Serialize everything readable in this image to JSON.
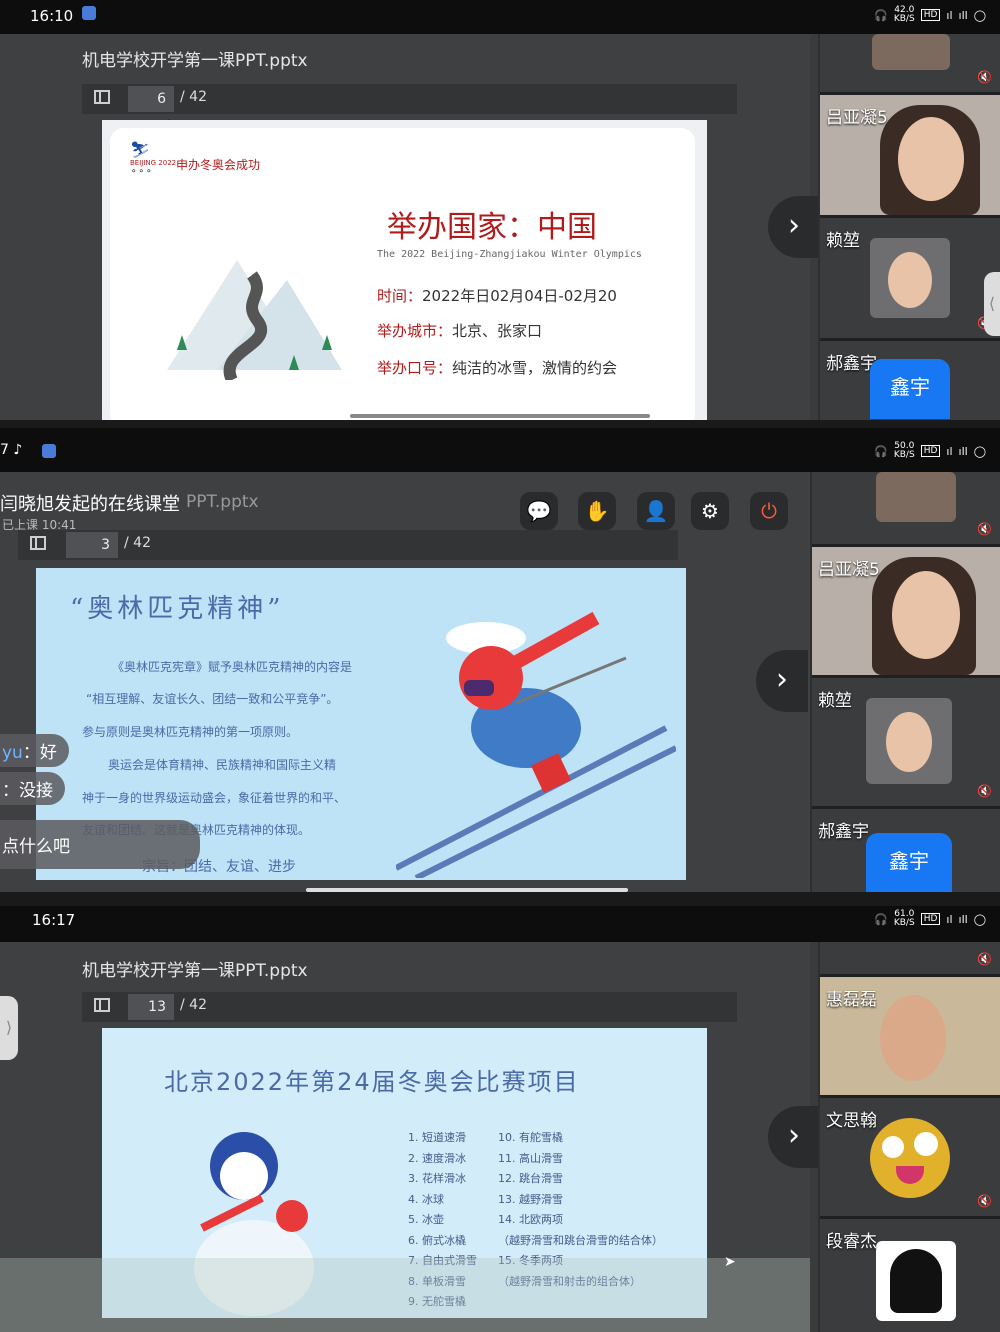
{
  "panel1": {
    "status_time": "16:10",
    "net_speed": "42.0",
    "net_unit": "KB/S",
    "filename": "机电学校开学第一课PPT.pptx",
    "page": "6",
    "page_total": "/ 42",
    "slide": {
      "logo_text": "BEIJING 2022",
      "header": "申办冬奥会成功",
      "title": "举办国家：中国",
      "subtitle": "The 2022 Beijing-Zhangjiakou Winter Olympics",
      "time_label": "时间：",
      "time_value": "2022年日02月04日-02月20",
      "city_label": "举办城市：",
      "city_value": "北京、张家口",
      "slogan_label": "举办口号：",
      "slogan_value": "纯洁的冰雪，激情的约会"
    },
    "participants": [
      "吕亚凝5",
      "赖堃",
      "郝鑫宇"
    ],
    "blue_avatar": "鑫宇"
  },
  "panel2": {
    "net_speed": "50.0",
    "net_unit": "KB/S",
    "class_title": "闫晓旭发起的在线课堂",
    "filename_tail": "PPT.pptx",
    "class_status": "已上课 10:41",
    "page": "3",
    "page_total": "/ 42",
    "slide": {
      "title": "“奥林匹克精神”",
      "p1": "《奥林匹克宪章》赋予奥林匹克精神的内容是",
      "p2": "“相互理解、友谊长久、团结一致和公平竞争”。",
      "p3": "参与原则是奥林匹克精神的第一项原则。",
      "p4": "奥运会是体育精神、民族精神和国际主义精",
      "p5": "神于一身的世界级运动盛会，象征着世界的和平、",
      "p6": "友谊和团结。这就是奥林匹克精神的体现。",
      "p7": "宗旨：团结、友谊、进步"
    },
    "chat": [
      {
        "user": "yu",
        "text": "：好"
      },
      {
        "user": "",
        "text": "：没接"
      },
      {
        "user": "",
        "text": "点什么吧"
      }
    ],
    "participants": [
      "吕亚凝5",
      "赖堃",
      "郝鑫宇"
    ],
    "blue_avatar": "鑫宇"
  },
  "panel3": {
    "status_time": "16:17",
    "net_speed": "61.0",
    "net_unit": "KB/S",
    "filename": "机电学校开学第一课PPT.pptx",
    "page": "13",
    "page_total": "/ 42",
    "slide": {
      "title": "北京2022年第24届冬奥会比赛项目",
      "events_left": [
        "1. 短道速滑",
        "2. 速度滑冰",
        "3. 花样滑冰",
        "4. 冰球",
        "5. 冰壶",
        "6. 俯式冰橇",
        "7. 自由式滑雪",
        "8. 单板滑雪",
        "9. 无舵雪橇"
      ],
      "events_right": [
        "10. 有舵雪橇",
        "11. 高山滑雪",
        "12. 跳台滑雪",
        "13. 越野滑雪",
        "14. 北欧两项",
        "（越野滑雪和跳台滑雪的结合体）",
        "15. 冬季两项",
        "（越野滑雪和射击的组合体）"
      ]
    },
    "participants": [
      "惠磊磊",
      "文思翰",
      "段睿杰"
    ]
  }
}
